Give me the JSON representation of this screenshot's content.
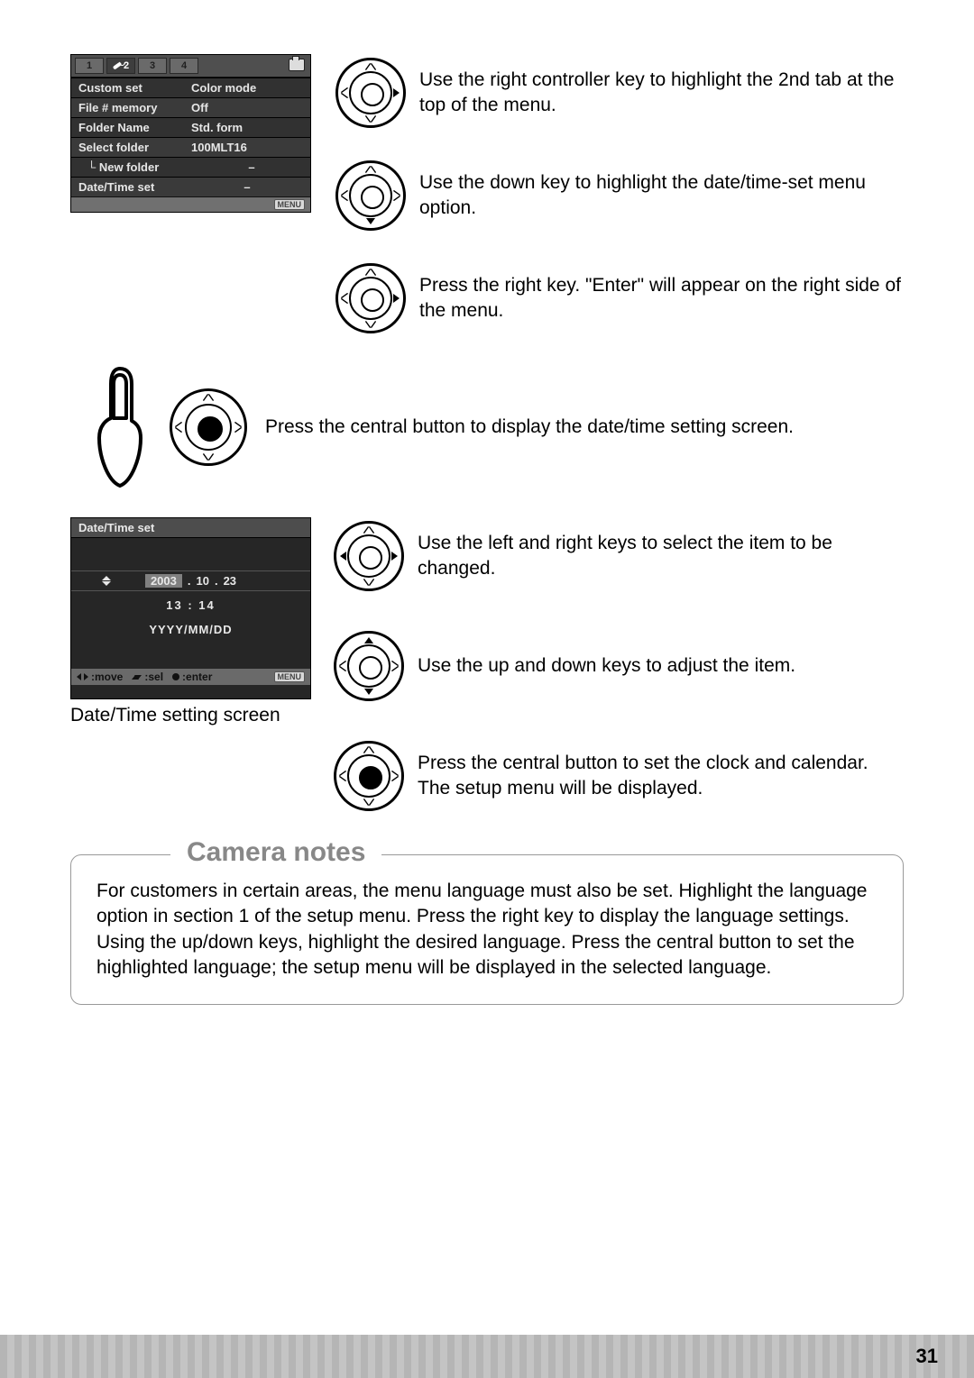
{
  "page_number": "31",
  "setup_menu": {
    "tabs": [
      "1",
      "2",
      "3",
      "4"
    ],
    "active_tab_index": 1,
    "rows": [
      {
        "label": "Custom set",
        "value": "Color mode"
      },
      {
        "label": "File # memory",
        "value": "Off"
      },
      {
        "label": "Folder Name",
        "value": "Std. form"
      },
      {
        "label": "Select folder",
        "value": "100MLT16"
      },
      {
        "label": "New folder",
        "value": "–",
        "indent": true
      },
      {
        "label": "Date/Time set",
        "value": "–"
      }
    ],
    "footer_badge": "MENU"
  },
  "steps_top": [
    "Use the right controller key to highlight the 2nd tab at the top of the menu.",
    "Use the down key to highlight the date/time-set menu option.",
    "Press the right key. \"Enter\" will appear on the right side of the menu."
  ],
  "step_center": "Press the central button to display the date/time setting screen.",
  "dt_screen": {
    "title": "Date/Time set",
    "year": "2003",
    "month": "10",
    "day": "23",
    "dot": ".",
    "time": "13  :  14",
    "format": "YYYY/MM/DD",
    "footer_move": ":move",
    "footer_sel": ":sel",
    "footer_enter": ":enter",
    "footer_badge": "MENU"
  },
  "dt_caption": "Date/Time setting screen",
  "steps_bottom": [
    "Use the left and right keys to select the item to be changed.",
    "Use the up and down keys to adjust the item.",
    "Press the central button to set the clock and calendar. The setup menu will be displayed."
  ],
  "notes": {
    "title": "Camera notes",
    "body": "For customers in certain areas, the menu language must also be set. Highlight the language option in section 1 of the setup menu. Press the right key to display the language settings. Using the up/down keys, highlight the desired language. Press the central button to set the highlighted language; the setup menu will be displayed in the selected language."
  }
}
